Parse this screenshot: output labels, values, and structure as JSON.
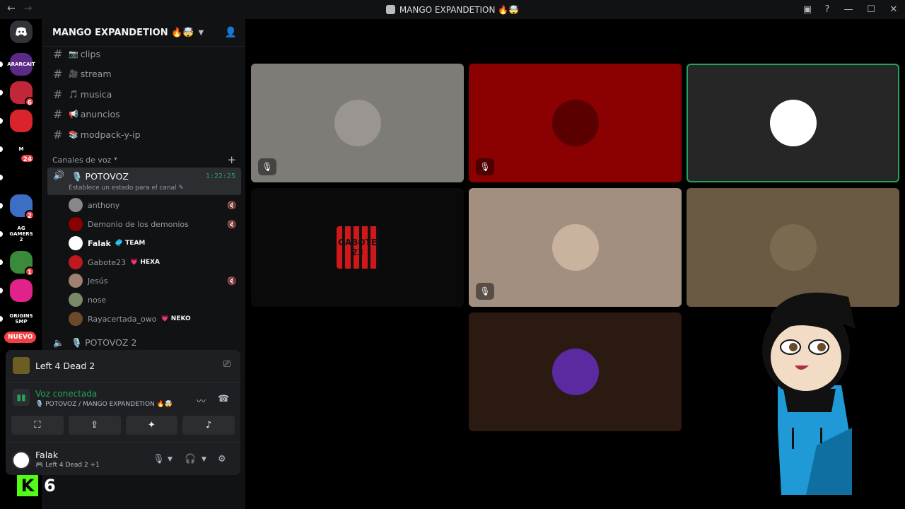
{
  "window": {
    "title": "MANGO EXPANDETION 🔥🤯",
    "back": "←",
    "forward": "→",
    "inbox": "▣",
    "help": "?",
    "minimize": "—",
    "maximize": "☐",
    "close": "✕"
  },
  "server_rail": {
    "discord_logo": "discord-logo",
    "nuevo_label": "NUEVO",
    "guilds": [
      {
        "label": "ARARCAIT",
        "color": "#5b2a86",
        "badge": ""
      },
      {
        "label": "",
        "color": "#c0283a",
        "badge": "6"
      },
      {
        "label": "",
        "color": "#d8242a",
        "badge": ""
      },
      {
        "label": "M",
        "color": "#000000",
        "badge": "24"
      },
      {
        "label": "",
        "color": "#000000",
        "badge": ""
      },
      {
        "label": "",
        "color": "#3b6ec4",
        "badge": "2"
      },
      {
        "label": "AG GAMERS 2",
        "color": "#000000",
        "badge": ""
      },
      {
        "label": "",
        "color": "#3a8a3c",
        "badge": "1"
      },
      {
        "label": "",
        "color": "#e0228a",
        "badge": ""
      },
      {
        "label": "ORIGINS SMP",
        "color": "#000000",
        "badge": ""
      }
    ]
  },
  "sidebar": {
    "server_name": "MANGO EXPANDETION 🔥🤯",
    "text_channels": [
      {
        "emoji": "📷",
        "name": "clips"
      },
      {
        "emoji": "🎥",
        "name": "stream"
      },
      {
        "emoji": "🎵",
        "name": "musica"
      },
      {
        "emoji": "📢",
        "name": "anuncios"
      },
      {
        "emoji": "📚",
        "name": "modpack-y-ip"
      }
    ],
    "voice_category": "Canales de voz",
    "active_voice": {
      "name": "🎙️ POTOVOZ",
      "time": "1:22:25",
      "status": "Establece un estado para el canal ✎"
    },
    "members": [
      {
        "name": "anthony",
        "tag": "",
        "color": "#888888"
      },
      {
        "name": "Demonio de los demonios",
        "tag": "",
        "color": "#8b0000"
      },
      {
        "name": "Falak",
        "tag": "🥏 TEAM",
        "color": "#ffffff"
      },
      {
        "name": "Gabote23",
        "tag": "💗 HEXA",
        "color": "#c0181c"
      },
      {
        "name": "Jesús",
        "tag": "",
        "color": "#a08070"
      },
      {
        "name": "nose",
        "tag": "",
        "color": "#7a8a66"
      },
      {
        "name": "Rayacertada_owo",
        "tag": "💗 NEKO",
        "color": "#6a4a2a"
      }
    ],
    "other_voice": "🎙️ POTOVOZ 2"
  },
  "panel": {
    "activity": "Left 4 Dead 2",
    "voice_status": "Voz conectada",
    "voice_location": "🎙️ POTOVOZ / MANGO EXPANDETION 🔥🤯",
    "user_name": "Falak",
    "user_activity": "🎮 Left 4 Dead 2 +1"
  },
  "overlay": {
    "kick_letter": "K",
    "kick_count": "6"
  },
  "tiles": [
    {
      "member": "anthony",
      "bg": "#7e7c77",
      "avatar": "#9a9590",
      "muted": true,
      "speaking": false
    },
    {
      "member": "Demonio de los demonios",
      "bg": "#8b0000",
      "avatar": "#5a0000",
      "muted": true,
      "speaking": false
    },
    {
      "member": "Falak",
      "bg": "#262626",
      "avatar": "#ffffff",
      "muted": false,
      "speaking": true
    },
    {
      "member": "Gabote23",
      "bg": "#0a0a0a",
      "avatar": "",
      "muted": false,
      "speaking": false
    },
    {
      "member": "Jesús",
      "bg": "#a38f7f",
      "avatar": "#c9b29e",
      "muted": true,
      "speaking": false
    },
    {
      "member": "nose",
      "bg": "#6b5a43",
      "avatar": "#7a6a50",
      "muted": false,
      "speaking": false
    },
    {
      "member": "Rayacertada_owo",
      "bg": "#2a1a12",
      "avatar": "#5b2aa0",
      "muted": false,
      "speaking": false
    }
  ],
  "gabote_logo_text": "GABOTE 23"
}
